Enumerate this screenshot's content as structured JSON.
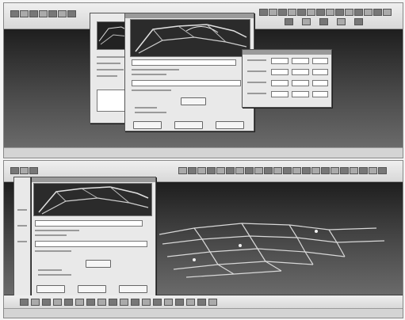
{
  "app": {
    "top_status_text": "",
    "bottom_status_text": ""
  },
  "icons": {
    "toolbar": "toolbar-icon",
    "render": "render-preview-icon"
  },
  "colors": {
    "background": "#f4f4f4",
    "viewport_dark": "#1e1e1e",
    "wireframe": "#d8d8d8",
    "dialog": "#e9e9e9"
  }
}
